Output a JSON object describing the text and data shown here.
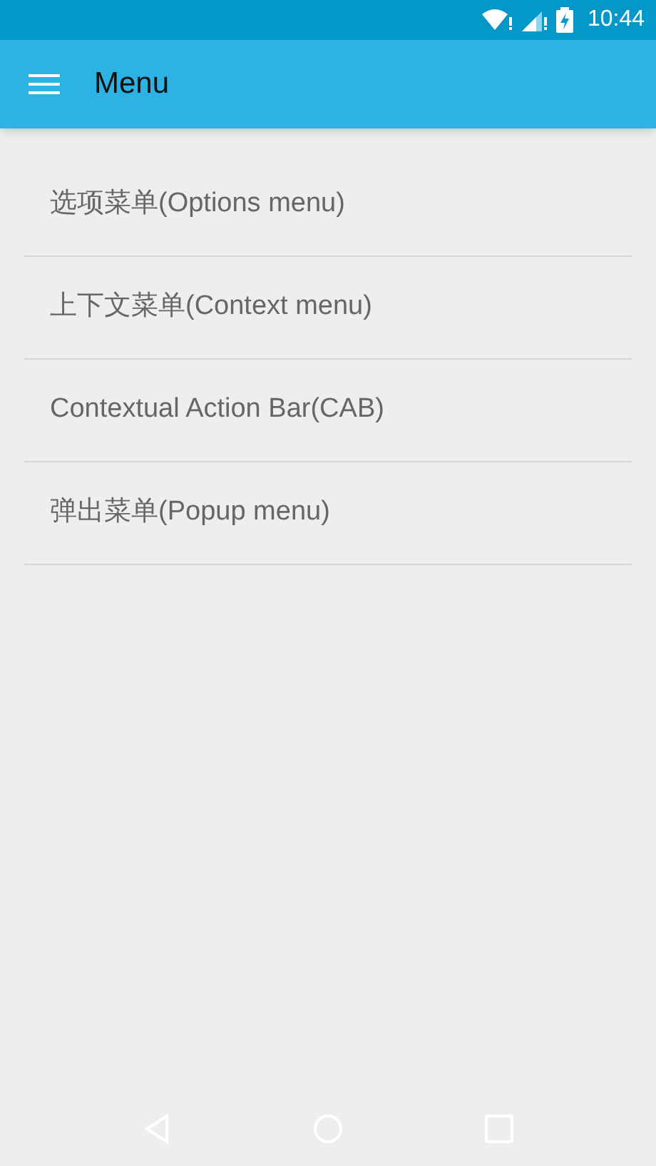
{
  "status_bar": {
    "time": "10:44"
  },
  "app_bar": {
    "title": "Menu"
  },
  "menu_items": [
    {
      "label": "选项菜单(Options menu)"
    },
    {
      "label": "上下文菜单(Context menu)"
    },
    {
      "label": "Contextual Action Bar(CAB)"
    },
    {
      "label": "弹出菜单(Popup menu)"
    }
  ]
}
